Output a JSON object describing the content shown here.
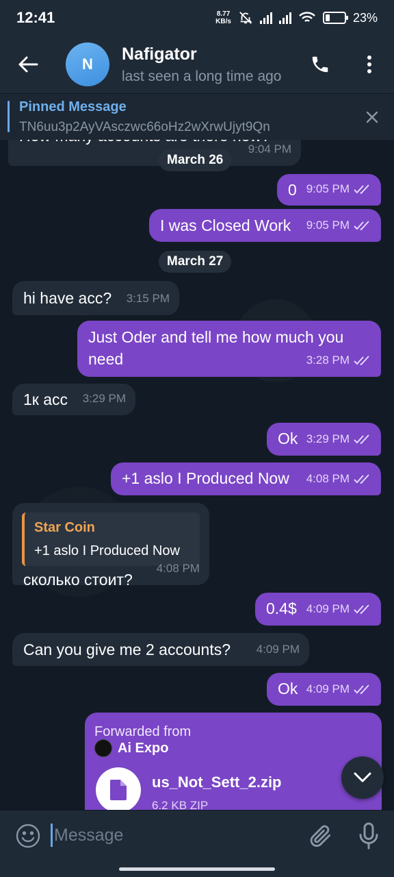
{
  "status_bar": {
    "time": "12:41",
    "net_speed_value": "8.77",
    "net_speed_unit": "KB/s",
    "battery": "23%",
    "battery_level": 0.23
  },
  "header": {
    "avatar_letter": "N",
    "name": "Nafigator",
    "status": "last seen a long time ago"
  },
  "pinned": {
    "title": "Pinned Message",
    "text": "TN6uu3p2AyVAsczwc66oHz2wXrwUjyt9Qn"
  },
  "messages": {
    "partial_top": {
      "text": "How many accounts are there now?",
      "time": "9:04 PM"
    },
    "date_1": "March 26",
    "m1": {
      "text": "0",
      "time": "9:05 PM"
    },
    "m2": {
      "text": "I was Closed Work",
      "time": "9:05 PM"
    },
    "date_2": "March 27",
    "m3": {
      "text": "hi have acc?",
      "time": "3:15 PM"
    },
    "m4": {
      "text": "Just Oder and tell me how much you need",
      "time": "3:28 PM"
    },
    "m5": {
      "text": "1к acc",
      "time": "3:29 PM"
    },
    "m6": {
      "text": "Ok",
      "time": "3:29 PM"
    },
    "m7": {
      "text": "+1 aslo I Produced Now",
      "time": "4:08 PM"
    },
    "m8": {
      "quote_name": "Star Coin",
      "quote_text": "+1 aslo I Produced Now",
      "text": "сколько стоит?",
      "time": "4:08 PM"
    },
    "m9": {
      "text": "0.4$",
      "time": "4:09 PM"
    },
    "m10": {
      "text": "Can you give me 2 accounts?",
      "time": "4:09 PM"
    },
    "m11": {
      "text": "Ok",
      "time": "4:09 PM"
    },
    "forward": {
      "header": "Forwarded from",
      "source": "Ai Expo",
      "file_name": "us_Not_Sett_2.zip",
      "file_size": "6.2 KB ZIP"
    }
  },
  "input": {
    "placeholder": "Message"
  },
  "colors": {
    "outgoing": "#7a45c6",
    "incoming": "#222c39",
    "accent": "#6aa8e8",
    "quote_accent": "#e89545"
  }
}
